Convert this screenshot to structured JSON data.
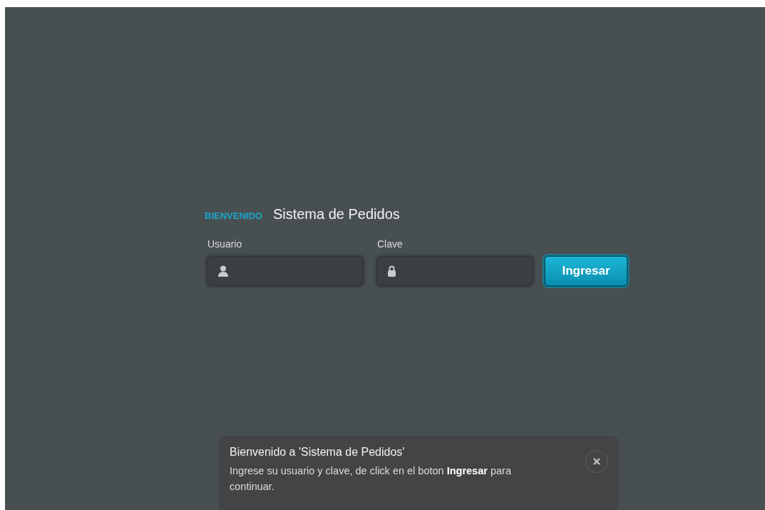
{
  "header": {
    "tag": "BIENVENIDO",
    "title": "Sistema de Pedidos"
  },
  "fields": [
    {
      "label": "Usuario",
      "kind": "user"
    },
    {
      "label": "Clave",
      "kind": "password"
    }
  ],
  "submit": {
    "label": "Ingresar"
  },
  "notification": {
    "title": "Bienvenido a 'Sistema de Pedidos'",
    "message": "Ingrese su usuario y clave, de click en el boton **Ingresar** para continuar."
  }
}
